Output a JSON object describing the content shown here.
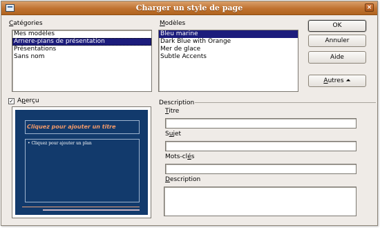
{
  "window": {
    "title": "Charger un style de page",
    "close_glyph": "×"
  },
  "categories": {
    "label_u": "C",
    "label_rest": "atégories",
    "items": [
      {
        "label": "Mes modèles"
      },
      {
        "label": "Arrière-plans de présentation"
      },
      {
        "label": "Présentations"
      },
      {
        "label": "Sans nom"
      }
    ],
    "selected_index": 1
  },
  "models": {
    "label_u": "M",
    "label_rest": "odèles",
    "items": [
      {
        "label": "Bleu marine"
      },
      {
        "label": "Dark Blue with Orange"
      },
      {
        "label": "Mer de glace"
      },
      {
        "label": "Subtle Accents"
      }
    ],
    "selected_index": 0
  },
  "buttons": {
    "ok": "OK",
    "cancel": "Annuler",
    "help": "Aide",
    "more_u": "A",
    "more_rest": "utres",
    "more_icon": "⏶"
  },
  "preview": {
    "checked": true,
    "check_glyph": "✓",
    "label_pre": "A",
    "label_u": "p",
    "label_rest": "erçu",
    "slide_title": "Cliquez pour ajouter un titre",
    "slide_body": "• Cliquez pour ajouter un plan",
    "colors": {
      "slide_bg": "#123a6c",
      "title_text": "#f29a6a"
    }
  },
  "description": {
    "group_label": "Description",
    "title_u": "T",
    "title_rest": "itre",
    "subject_pre": "S",
    "subject_u": "u",
    "subject_rest": "jet",
    "keywords_pre": "Mots-cl",
    "keywords_u": "é",
    "keywords_rest": "s",
    "desc_u": "D",
    "desc_rest": "escription",
    "title_value": "",
    "subject_value": "",
    "keywords_value": "",
    "description_value": ""
  },
  "colors": {
    "titlebar": "#c07230",
    "selection": "#1c1c7c",
    "dialog_bg": "#efebe7"
  }
}
